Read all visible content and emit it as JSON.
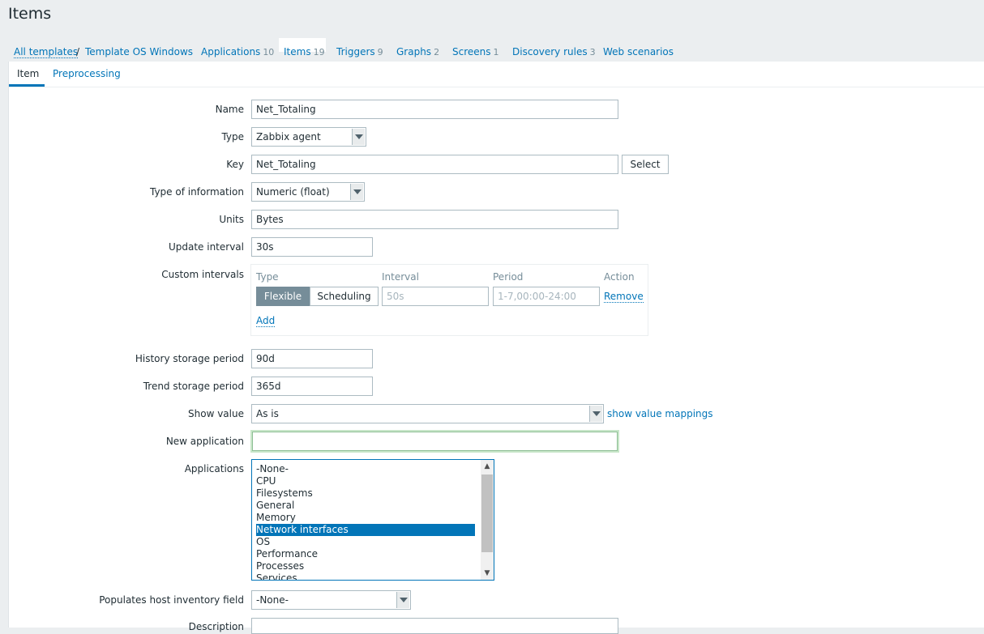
{
  "page": {
    "title": "Items"
  },
  "nav": {
    "all_templates": "All templates",
    "separator": "/",
    "template": "Template OS Windows",
    "applications": {
      "label": "Applications",
      "count": "10"
    },
    "items": {
      "label": "Items",
      "count": "19"
    },
    "triggers": {
      "label": "Triggers",
      "count": "9"
    },
    "graphs": {
      "label": "Graphs",
      "count": "2"
    },
    "screens": {
      "label": "Screens",
      "count": "1"
    },
    "discovery": {
      "label": "Discovery rules",
      "count": "3"
    },
    "web": {
      "label": "Web scenarios"
    }
  },
  "tabs": {
    "item": "Item",
    "preprocessing": "Preprocessing"
  },
  "form": {
    "name": {
      "label": "Name",
      "value": "Net_Totaling"
    },
    "type": {
      "label": "Type",
      "value": "Zabbix agent"
    },
    "key": {
      "label": "Key",
      "value": "Net_Totaling",
      "select_button": "Select"
    },
    "type_info": {
      "label": "Type of information",
      "value": "Numeric (float)"
    },
    "units": {
      "label": "Units",
      "value": "Bytes"
    },
    "update_interval": {
      "label": "Update interval",
      "value": "30s"
    },
    "custom_intervals": {
      "label": "Custom intervals",
      "headers": {
        "type": "Type",
        "interval": "Interval",
        "period": "Period",
        "action": "Action"
      },
      "flexible": "Flexible",
      "scheduling": "Scheduling",
      "interval_placeholder": "50s",
      "period_placeholder": "1-7,00:00-24:00",
      "remove": "Remove",
      "add": "Add"
    },
    "history": {
      "label": "History storage period",
      "value": "90d"
    },
    "trend": {
      "label": "Trend storage period",
      "value": "365d"
    },
    "show_value": {
      "label": "Show value",
      "value": "As is",
      "mappings_link": "show value mappings"
    },
    "new_application": {
      "label": "New application",
      "value": ""
    },
    "applications": {
      "label": "Applications",
      "options": [
        "-None-",
        "CPU",
        "Filesystems",
        "General",
        "Memory",
        "Network interfaces",
        "OS",
        "Performance",
        "Processes",
        "Services"
      ],
      "selected": "Network interfaces"
    },
    "inventory": {
      "label": "Populates host inventory field",
      "value": "-None-"
    },
    "description": {
      "label": "Description"
    }
  },
  "colors": {
    "link": "#0275b8",
    "flexible_active": "#768d99",
    "background": "#ebeef0"
  }
}
